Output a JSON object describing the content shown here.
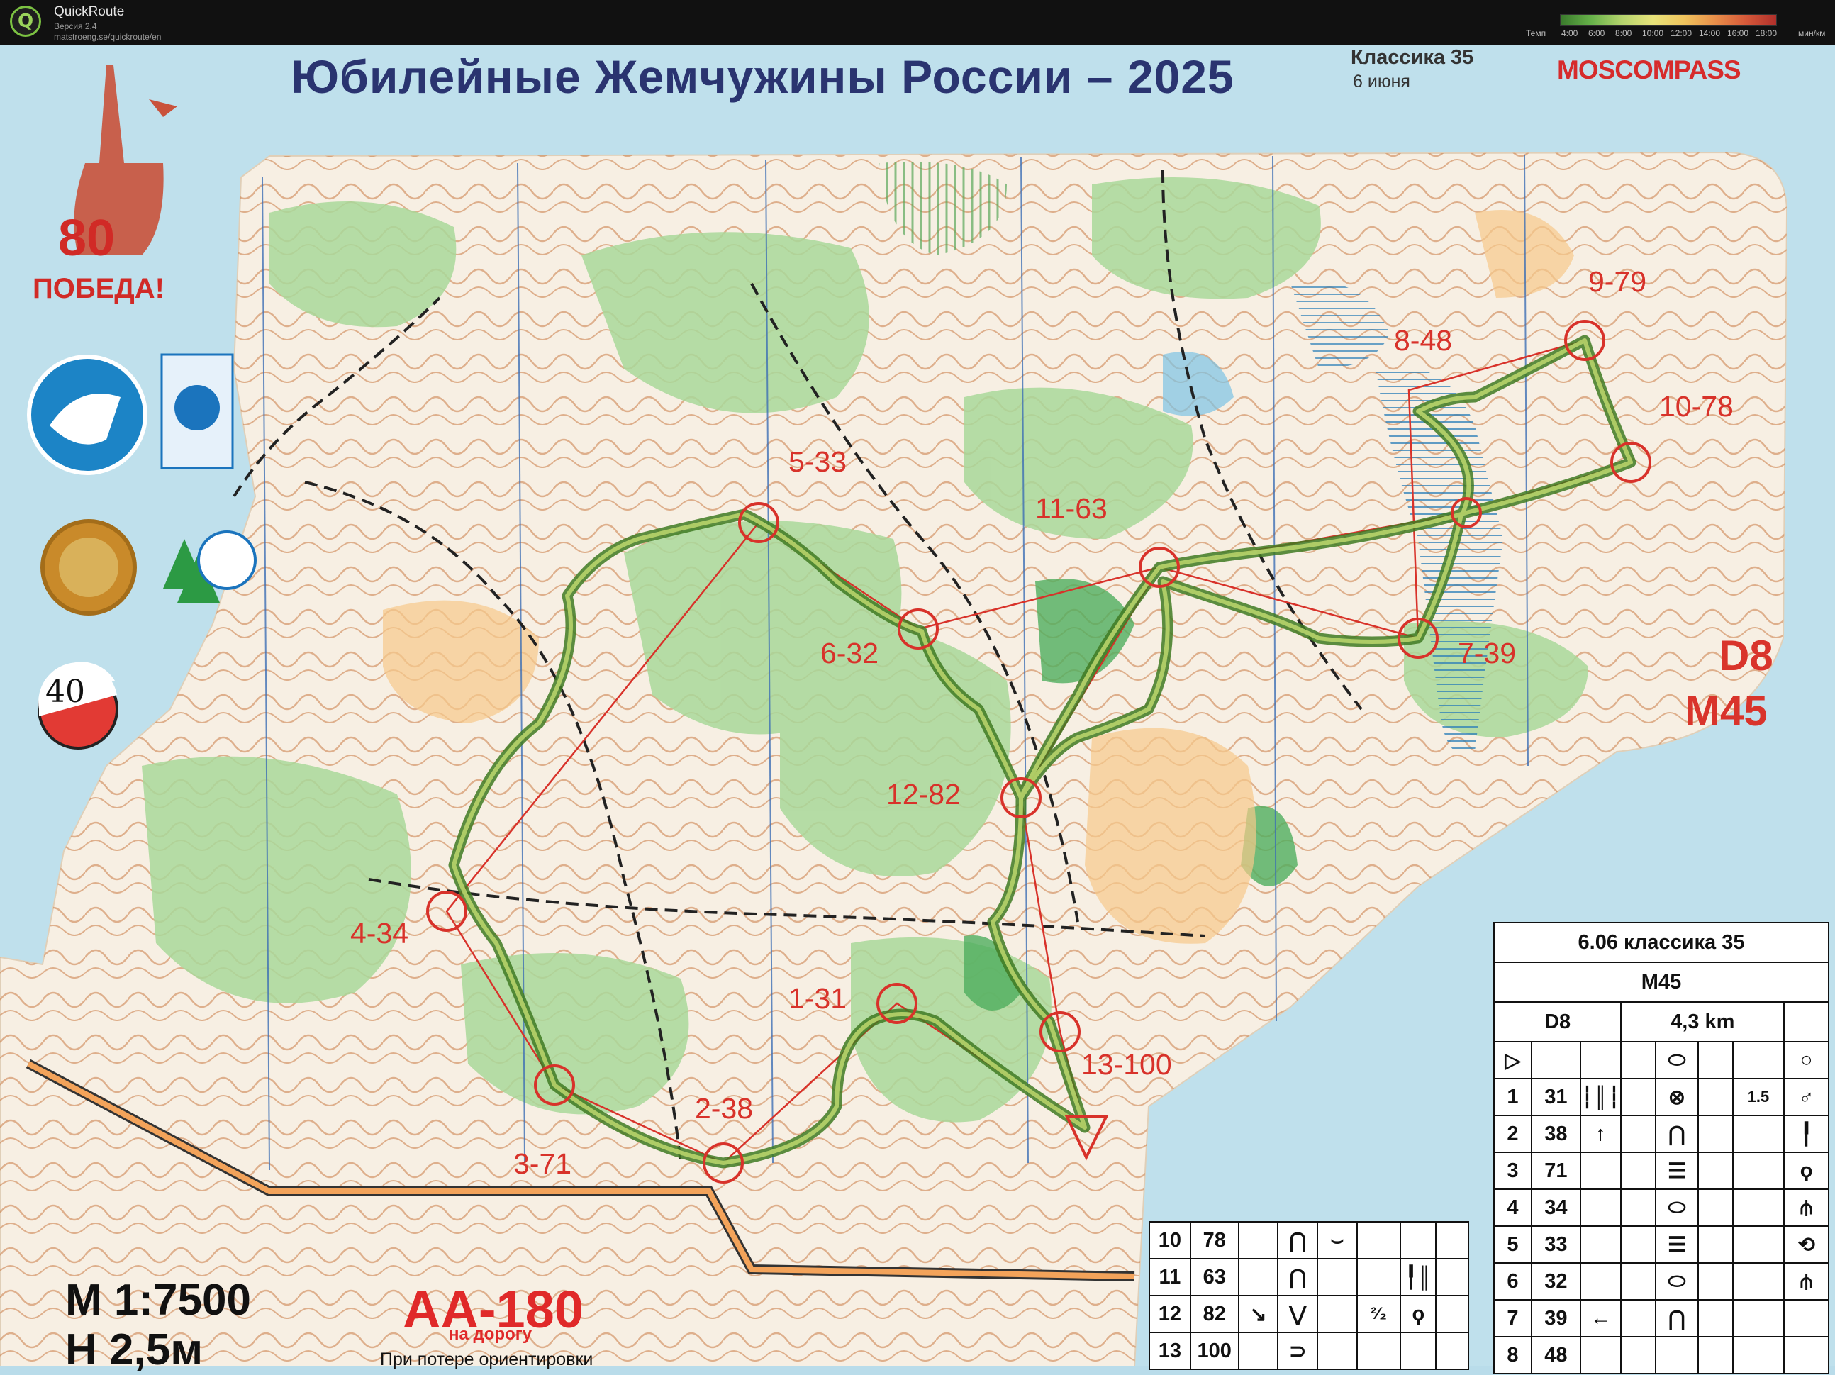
{
  "app": {
    "name": "QuickRoute",
    "version": "Версия 2.4",
    "url": "matstroeng.se/quickroute/en",
    "logo_letter": "Q"
  },
  "speed_legend": {
    "label_left": "Темп",
    "ticks": [
      "4:00",
      "6:00",
      "8:00",
      "10:00",
      "12:00",
      "14:00",
      "16:00",
      "18:00"
    ],
    "unit": "мин/км"
  },
  "map_header": {
    "title": "Юбилейные Жемчужины России – 2025",
    "event": "Классика 35",
    "date": "6 июня",
    "sponsor": "MOSCOMPASS",
    "badge_80": "80",
    "badge_pobeda": "ПОБЕДА!",
    "badge_40": "40"
  },
  "course": {
    "class1": "D8",
    "class2": "M45"
  },
  "controls": [
    {
      "label": "1-31"
    },
    {
      "label": "2-38"
    },
    {
      "label": "3-71"
    },
    {
      "label": "4-34"
    },
    {
      "label": "5-33"
    },
    {
      "label": "6-32"
    },
    {
      "label": "7-39"
    },
    {
      "label": "8-48"
    },
    {
      "label": "9-79"
    },
    {
      "label": "10-78"
    },
    {
      "label": "11-63"
    },
    {
      "label": "12-82"
    },
    {
      "label": "13-100"
    }
  ],
  "footer": {
    "scale": "М 1:7500",
    "contour": "Н 2,5м",
    "road_title": "АА-180",
    "road_sub": "на дорогу",
    "road_note": "При потере ориентировки"
  },
  "description_sheet": {
    "header": "6.06 классика 35",
    "class": "M45",
    "course": "D8",
    "length": "4,3 km",
    "start_symbols": [
      "▷",
      "",
      "",
      "",
      "⬭",
      "",
      "",
      "○"
    ],
    "rows": [
      {
        "num": "1",
        "code": "31",
        "c": "┆║┆",
        "d": "",
        "e": "⊗",
        "f": "",
        "g": "1.5",
        "h": "♂"
      },
      {
        "num": "2",
        "code": "38",
        "c": "↑",
        "d": "",
        "e": "⋂",
        "f": "",
        "g": "",
        "h": "╿"
      },
      {
        "num": "3",
        "code": "71",
        "c": "",
        "d": "",
        "e": "☰",
        "f": "",
        "g": "",
        "h": "ϙ"
      },
      {
        "num": "4",
        "code": "34",
        "c": "",
        "d": "",
        "e": "⬭",
        "f": "",
        "g": "",
        "h": "⫛"
      },
      {
        "num": "5",
        "code": "33",
        "c": "",
        "d": "",
        "e": "☰",
        "f": "",
        "g": "",
        "h": "⟲"
      },
      {
        "num": "6",
        "code": "32",
        "c": "",
        "d": "",
        "e": "⬭",
        "f": "",
        "g": "",
        "h": "⫛"
      },
      {
        "num": "7",
        "code": "39",
        "c": "←",
        "d": "",
        "e": "⋂",
        "f": "",
        "g": "",
        "h": ""
      },
      {
        "num": "8",
        "code": "48",
        "c": "",
        "d": "",
        "e": "",
        "f": "",
        "g": "",
        "h": ""
      }
    ],
    "rows_left": [
      {
        "num": "10",
        "code": "78",
        "c": "",
        "d": "⋂",
        "e": "⌣",
        "f": "",
        "g": "",
        "h": ""
      },
      {
        "num": "11",
        "code": "63",
        "c": "",
        "d": "⋂",
        "e": "",
        "f": "",
        "g": "╿║",
        "h": ""
      },
      {
        "num": "12",
        "code": "82",
        "c": "↘",
        "d": "⋁",
        "e": "",
        "f": "²⁄₂",
        "g": "ϙ",
        "h": ""
      },
      {
        "num": "13",
        "code": "100",
        "c": "",
        "d": "⊃",
        "e": "",
        "f": "",
        "g": "",
        "h": ""
      }
    ]
  }
}
